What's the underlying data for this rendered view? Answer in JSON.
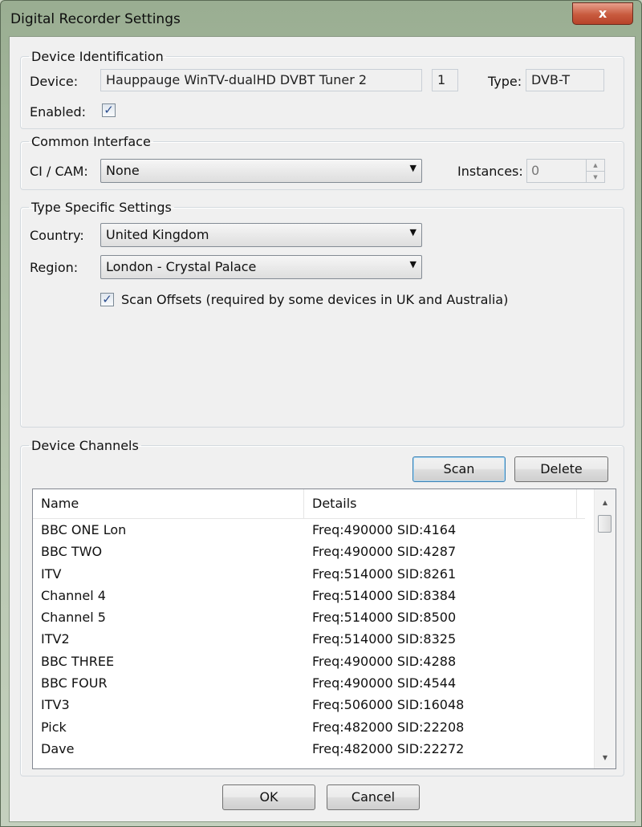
{
  "window": {
    "title": "Digital Recorder Settings",
    "close_glyph": "x"
  },
  "device_identification": {
    "legend": "Device Identification",
    "device_label": "Device:",
    "device_value": "Hauppauge WinTV-dualHD DVBT Tuner 2",
    "device_index": "1",
    "type_label": "Type:",
    "type_value": "DVB-T",
    "enabled_label": "Enabled:",
    "enabled_checked": true
  },
  "common_interface": {
    "legend": "Common Interface",
    "ci_label": "CI / CAM:",
    "ci_value": "None",
    "instances_label": "Instances:",
    "instances_value": "0"
  },
  "type_specific": {
    "legend": "Type Specific Settings",
    "country_label": "Country:",
    "country_value": "United Kingdom",
    "region_label": "Region:",
    "region_value": "London - Crystal Palace",
    "scan_offsets_label": "Scan Offsets (required by some devices in UK and Australia)",
    "scan_offsets_checked": true
  },
  "device_channels": {
    "legend": "Device Channels",
    "scan_button": "Scan",
    "delete_button": "Delete",
    "columns": [
      "Name",
      "Details"
    ],
    "rows": [
      {
        "name": "BBC ONE Lon",
        "details": "Freq:490000 SID:4164"
      },
      {
        "name": "BBC TWO",
        "details": "Freq:490000 SID:4287"
      },
      {
        "name": "ITV",
        "details": "Freq:514000 SID:8261"
      },
      {
        "name": "Channel 4",
        "details": "Freq:514000 SID:8384"
      },
      {
        "name": "Channel 5",
        "details": "Freq:514000 SID:8500"
      },
      {
        "name": "ITV2",
        "details": "Freq:514000 SID:8325"
      },
      {
        "name": "BBC THREE",
        "details": "Freq:490000 SID:4288"
      },
      {
        "name": "BBC FOUR",
        "details": "Freq:490000 SID:4544"
      },
      {
        "name": "ITV3",
        "details": "Freq:506000 SID:16048"
      },
      {
        "name": "Pick",
        "details": "Freq:482000 SID:22208"
      },
      {
        "name": "Dave",
        "details": "Freq:482000 SID:22272"
      }
    ]
  },
  "footer": {
    "ok_button": "OK",
    "cancel_button": "Cancel"
  }
}
